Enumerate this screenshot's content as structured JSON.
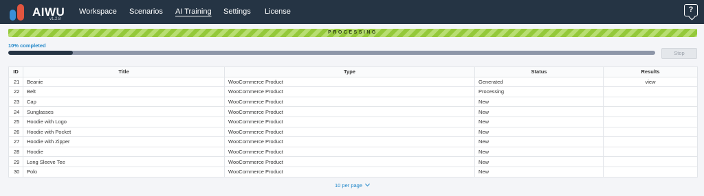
{
  "app": {
    "brand": "AIWU",
    "version": "v1.2.8"
  },
  "nav": [
    {
      "label": "Workspace",
      "active": false
    },
    {
      "label": "Scenarios",
      "active": false
    },
    {
      "label": "AI Training",
      "active": true
    },
    {
      "label": "Settings",
      "active": false
    },
    {
      "label": "License",
      "active": false
    }
  ],
  "help_icon": "help-question-icon",
  "banner": {
    "label": "PROCESSING",
    "color": "#94c93a"
  },
  "progress": {
    "label": "10% completed",
    "fraction": 0.1
  },
  "stop_button": "Stop",
  "table": {
    "columns": [
      "ID",
      "Title",
      "Type",
      "Status",
      "Results"
    ],
    "rows": [
      {
        "id": "21",
        "title": "Beanie",
        "type": "WooCommerce Product",
        "status": "Generated",
        "results": "view"
      },
      {
        "id": "22",
        "title": "Belt",
        "type": "WooCommerce Product",
        "status": "Processing",
        "results": ""
      },
      {
        "id": "23",
        "title": "Cap",
        "type": "WooCommerce Product",
        "status": "New",
        "results": ""
      },
      {
        "id": "24",
        "title": "Sunglasses",
        "type": "WooCommerce Product",
        "status": "New",
        "results": ""
      },
      {
        "id": "25",
        "title": "Hoodie with Logo",
        "type": "WooCommerce Product",
        "status": "New",
        "results": ""
      },
      {
        "id": "26",
        "title": "Hoodie with Pocket",
        "type": "WooCommerce Product",
        "status": "New",
        "results": ""
      },
      {
        "id": "27",
        "title": "Hoodie with Zipper",
        "type": "WooCommerce Product",
        "status": "New",
        "results": ""
      },
      {
        "id": "28",
        "title": "Hoodie",
        "type": "WooCommerce Product",
        "status": "New",
        "results": ""
      },
      {
        "id": "29",
        "title": "Long Sleeve Tee",
        "type": "WooCommerce Product",
        "status": "New",
        "results": ""
      },
      {
        "id": "30",
        "title": "Polo",
        "type": "WooCommerce Product",
        "status": "New",
        "results": ""
      }
    ]
  },
  "pagination": {
    "per_page_label": "10 per page"
  }
}
